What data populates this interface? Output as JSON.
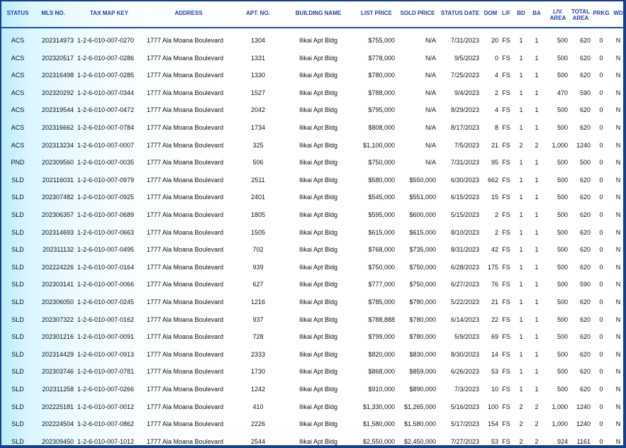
{
  "headers": [
    {
      "key": "status",
      "label": "STATUS"
    },
    {
      "key": "mls",
      "label": "MLS NO."
    },
    {
      "key": "tmk",
      "label": "TAX MAP KEY"
    },
    {
      "key": "address",
      "label": "ADDRESS"
    },
    {
      "key": "apt",
      "label": "APT. NO."
    },
    {
      "key": "building",
      "label": "BUILDING NAME"
    },
    {
      "key": "list",
      "label": "LIST PRICE"
    },
    {
      "key": "sold",
      "label": "SOLD PRICE"
    },
    {
      "key": "date",
      "label": "STATUS DATE"
    },
    {
      "key": "dom",
      "label": "DOM"
    },
    {
      "key": "lf",
      "label": "L/F"
    },
    {
      "key": "bd",
      "label": "BD"
    },
    {
      "key": "ba",
      "label": "BA"
    },
    {
      "key": "liv",
      "label": "LIV.\nAREA"
    },
    {
      "key": "total",
      "label": "TOTAL\nAREA"
    },
    {
      "key": "prkg",
      "label": "PRKG"
    },
    {
      "key": "wd",
      "label": "WD"
    }
  ],
  "rows": [
    {
      "status": "ACS",
      "mls": "202314973",
      "tmk": "1-2-6-010-007-0270",
      "address": "1777 Ala Moana Boulevard",
      "apt": "1304",
      "building": "Ilikai Apt Bldg",
      "list": "$755,000",
      "sold": "N/A",
      "date": "7/31/2023",
      "dom": "20",
      "lf": "FS",
      "bd": "1",
      "ba": "1",
      "liv": "500",
      "total": "620",
      "prkg": "0",
      "wd": "N"
    },
    {
      "status": "ACS",
      "mls": "202320517",
      "tmk": "1-2-6-010-007-0286",
      "address": "1777 Ala Moana Boulevard",
      "apt": "1331",
      "building": "Ilikai Apt Bldg",
      "list": "$778,000",
      "sold": "N/A",
      "date": "9/5/2023",
      "dom": "0",
      "lf": "FS",
      "bd": "1",
      "ba": "1",
      "liv": "500",
      "total": "620",
      "prkg": "0",
      "wd": "N"
    },
    {
      "status": "ACS",
      "mls": "202316498",
      "tmk": "1-2-6-010-007-0285",
      "address": "1777 Ala Moana Boulevard",
      "apt": "1330",
      "building": "Ilikai Apt Bldg",
      "list": "$780,000",
      "sold": "N/A",
      "date": "7/25/2023",
      "dom": "4",
      "lf": "FS",
      "bd": "1",
      "ba": "1",
      "liv": "500",
      "total": "620",
      "prkg": "0",
      "wd": "N"
    },
    {
      "status": "ACS",
      "mls": "202320292",
      "tmk": "1-2-6-010-007-0344",
      "address": "1777 Ala Moana Boulevard",
      "apt": "1527",
      "building": "Ilikai Apt Bldg",
      "list": "$788,000",
      "sold": "N/A",
      "date": "9/4/2023",
      "dom": "2",
      "lf": "FS",
      "bd": "1",
      "ba": "1",
      "liv": "470",
      "total": "590",
      "prkg": "0",
      "wd": "N"
    },
    {
      "status": "ACS",
      "mls": "202319544",
      "tmk": "1-2-6-010-007-0472",
      "address": "1777 Ala Moana Boulevard",
      "apt": "2042",
      "building": "Ilikai Apt Bldg",
      "list": "$795,000",
      "sold": "N/A",
      "date": "8/29/2023",
      "dom": "4",
      "lf": "FS",
      "bd": "1",
      "ba": "1",
      "liv": "500",
      "total": "620",
      "prkg": "0",
      "wd": "N"
    },
    {
      "status": "ACS",
      "mls": "202316662",
      "tmk": "1-2-6-010-007-0784",
      "address": "1777 Ala Moana Boulevard",
      "apt": "1734",
      "building": "Ilikai Apt Bldg",
      "list": "$808,000",
      "sold": "N/A",
      "date": "8/17/2023",
      "dom": "8",
      "lf": "FS",
      "bd": "1",
      "ba": "1",
      "liv": "500",
      "total": "620",
      "prkg": "0",
      "wd": "N"
    },
    {
      "status": "ACS",
      "mls": "202313234",
      "tmk": "1-2-6-010-007-0007",
      "address": "1777 Ala Moana Boulevard",
      "apt": "325",
      "building": "Ilikai Apt Bldg",
      "list": "$1,100,000",
      "sold": "N/A",
      "date": "7/5/2023",
      "dom": "21",
      "lf": "FS",
      "bd": "2",
      "ba": "2",
      "liv": "1,000",
      "total": "1240",
      "prkg": "0",
      "wd": "N"
    },
    {
      "status": "PND",
      "mls": "202309560",
      "tmk": "1-2-6-010-007-0035",
      "address": "1777 Ala Moana Boulevard",
      "apt": "506",
      "building": "Ilikai Apt Bldg",
      "list": "$750,000",
      "sold": "N/A",
      "date": "7/31/2023",
      "dom": "95",
      "lf": "FS",
      "bd": "1",
      "ba": "1",
      "liv": "500",
      "total": "500",
      "prkg": "0",
      "wd": "N"
    },
    {
      "status": "SLD",
      "mls": "202116031",
      "tmk": "1-2-6-010-007-0979",
      "address": "1777 Ala Moana Boulevard",
      "apt": "2511",
      "building": "Ilikai Apt Bldg",
      "list": "$580,000",
      "sold": "$550,000",
      "date": "6/30/2023",
      "dom": "662",
      "lf": "FS",
      "bd": "1",
      "ba": "1",
      "liv": "500",
      "total": "620",
      "prkg": "0",
      "wd": "N"
    },
    {
      "status": "SLD",
      "mls": "202307482",
      "tmk": "1-2-6-010-007-0925",
      "address": "1777 Ala Moana Boulevard",
      "apt": "2401",
      "building": "Ilikai Apt Bldg",
      "list": "$545,000",
      "sold": "$551,000",
      "date": "6/15/2023",
      "dom": "15",
      "lf": "FS",
      "bd": "1",
      "ba": "1",
      "liv": "500",
      "total": "620",
      "prkg": "0",
      "wd": "N"
    },
    {
      "status": "SLD",
      "mls": "202306357",
      "tmk": "1-2-6-010-007-0689",
      "address": "1777 Ala Moana Boulevard",
      "apt": "1805",
      "building": "Ilikai Apt Bldg",
      "list": "$595,000",
      "sold": "$600,000",
      "date": "5/15/2023",
      "dom": "2",
      "lf": "FS",
      "bd": "1",
      "ba": "1",
      "liv": "500",
      "total": "620",
      "prkg": "0",
      "wd": "N"
    },
    {
      "status": "SLD",
      "mls": "202314693",
      "tmk": "1-2-6-010-007-0663",
      "address": "1777 Ala Moana Boulevard",
      "apt": "1505",
      "building": "Ilikai Apt Bldg",
      "list": "$615,000",
      "sold": "$615,000",
      "date": "8/10/2023",
      "dom": "2",
      "lf": "FS",
      "bd": "1",
      "ba": "1",
      "liv": "500",
      "total": "620",
      "prkg": "0",
      "wd": "N"
    },
    {
      "status": "SLD",
      "mls": "202311132",
      "tmk": "1-2-6-010-007-0495",
      "address": "1777 Ala Moana Boulevard",
      "apt": "702",
      "building": "Ilikai Apt Bldg",
      "list": "$768,000",
      "sold": "$735,000",
      "date": "8/31/2023",
      "dom": "42",
      "lf": "FS",
      "bd": "1",
      "ba": "1",
      "liv": "500",
      "total": "620",
      "prkg": "0",
      "wd": "N"
    },
    {
      "status": "SLD",
      "mls": "202224226",
      "tmk": "1-2-6-010-007-0164",
      "address": "1777 Ala Moana Boulevard",
      "apt": "939",
      "building": "Ilikai Apt Bldg",
      "list": "$750,000",
      "sold": "$750,000",
      "date": "6/28/2023",
      "dom": "175",
      "lf": "FS",
      "bd": "1",
      "ba": "1",
      "liv": "500",
      "total": "620",
      "prkg": "0",
      "wd": "N"
    },
    {
      "status": "SLD",
      "mls": "202303141",
      "tmk": "1-2-6-010-007-0066",
      "address": "1777 Ala Moana Boulevard",
      "apt": "627",
      "building": "Ilikai Apt Bldg",
      "list": "$777,000",
      "sold": "$750,000",
      "date": "6/27/2023",
      "dom": "76",
      "lf": "FS",
      "bd": "1",
      "ba": "1",
      "liv": "500",
      "total": "590",
      "prkg": "0",
      "wd": "N"
    },
    {
      "status": "SLD",
      "mls": "202306050",
      "tmk": "1-2-6-010-007-0245",
      "address": "1777 Ala Moana Boulevard",
      "apt": "1216",
      "building": "Ilikai Apt Bldg",
      "list": "$785,000",
      "sold": "$780,000",
      "date": "5/22/2023",
      "dom": "21",
      "lf": "FS",
      "bd": "1",
      "ba": "1",
      "liv": "500",
      "total": "620",
      "prkg": "0",
      "wd": "N"
    },
    {
      "status": "SLD",
      "mls": "202307322",
      "tmk": "1-2-6-010-007-0162",
      "address": "1777 Ala Moana Boulevard",
      "apt": "937",
      "building": "Ilikai Apt Bldg",
      "list": "$788,888",
      "sold": "$780,000",
      "date": "6/14/2023",
      "dom": "22",
      "lf": "FS",
      "bd": "1",
      "ba": "1",
      "liv": "500",
      "total": "620",
      "prkg": "0",
      "wd": "N"
    },
    {
      "status": "SLD",
      "mls": "202301216",
      "tmk": "1-2-6-010-007-0091",
      "address": "1777 Ala Moana Boulevard",
      "apt": "728",
      "building": "Ilikai Apt Bldg",
      "list": "$799,000",
      "sold": "$780,000",
      "date": "5/9/2023",
      "dom": "69",
      "lf": "FS",
      "bd": "1",
      "ba": "1",
      "liv": "500",
      "total": "620",
      "prkg": "0",
      "wd": "N"
    },
    {
      "status": "SLD",
      "mls": "202314429",
      "tmk": "1-2-6-010-007-0913",
      "address": "1777 Ala Moana Boulevard",
      "apt": "2333",
      "building": "Ilikai Apt Bldg",
      "list": "$820,000",
      "sold": "$830,000",
      "date": "8/30/2023",
      "dom": "14",
      "lf": "FS",
      "bd": "1",
      "ba": "1",
      "liv": "500",
      "total": "620",
      "prkg": "0",
      "wd": "N"
    },
    {
      "status": "SLD",
      "mls": "202303746",
      "tmk": "1-2-6-010-007-0781",
      "address": "1777 Ala Moana Boulevard",
      "apt": "1730",
      "building": "Ilikai Apt Bldg",
      "list": "$868,000",
      "sold": "$859,000",
      "date": "6/26/2023",
      "dom": "53",
      "lf": "FS",
      "bd": "1",
      "ba": "1",
      "liv": "500",
      "total": "620",
      "prkg": "0",
      "wd": "N"
    },
    {
      "status": "SLD",
      "mls": "202311258",
      "tmk": "1-2-6-010-007-0266",
      "address": "1777 Ala Moana Boulevard",
      "apt": "1242",
      "building": "Ilikai Apt Bldg",
      "list": "$910,000",
      "sold": "$890,000",
      "date": "7/3/2023",
      "dom": "10",
      "lf": "FS",
      "bd": "1",
      "ba": "1",
      "liv": "500",
      "total": "620",
      "prkg": "0",
      "wd": "N"
    },
    {
      "status": "SLD",
      "mls": "202225181",
      "tmk": "1-2-6-010-007-0012",
      "address": "1777 Ala Moana Boulevard",
      "apt": "410",
      "building": "Ilikai Apt Bldg",
      "list": "$1,330,000",
      "sold": "$1,265,000",
      "date": "5/16/2023",
      "dom": "100",
      "lf": "FS",
      "bd": "2",
      "ba": "2",
      "liv": "1,000",
      "total": "1240",
      "prkg": "0",
      "wd": "N"
    },
    {
      "status": "SLD",
      "mls": "202224504",
      "tmk": "1-2-6-010-007-0862",
      "address": "1777 Ala Moana Boulevard",
      "apt": "2226",
      "building": "Ilikai Apt Bldg",
      "list": "$1,580,000",
      "sold": "$1,580,000",
      "date": "5/17/2023",
      "dom": "154",
      "lf": "FS",
      "bd": "2",
      "ba": "2",
      "liv": "1,000",
      "total": "1240",
      "prkg": "0",
      "wd": "N"
    },
    {
      "status": "SLD",
      "mls": "202309450",
      "tmk": "1-2-6-010-007-1012",
      "address": "1777 Ala Moana Boulevard",
      "apt": "2544",
      "building": "Ilikai Apt Bldg",
      "list": "$2,550,000",
      "sold": "$2,450,000",
      "date": "7/27/2023",
      "dom": "53",
      "lf": "FS",
      "bd": "2",
      "ba": "2",
      "liv": "924",
      "total": "1161",
      "prkg": "0",
      "wd": "N"
    }
  ]
}
